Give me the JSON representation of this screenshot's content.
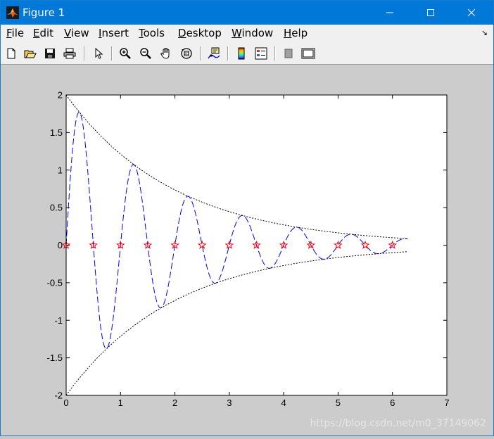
{
  "window": {
    "title": "Figure 1",
    "icons": {
      "app": "matlab-logo-icon",
      "minimize": "minimize-icon",
      "maximize": "maximize-icon",
      "close": "close-icon"
    }
  },
  "menubar": {
    "items": [
      {
        "label": "File",
        "key": "F"
      },
      {
        "label": "Edit",
        "key": "E"
      },
      {
        "label": "View",
        "key": "V"
      },
      {
        "label": "Insert",
        "key": "I"
      },
      {
        "label": "Tools",
        "key": "T"
      },
      {
        "label": "Desktop",
        "key": "D"
      },
      {
        "label": "Window",
        "key": "W"
      },
      {
        "label": "Help",
        "key": "H"
      }
    ],
    "dock_icon": "dock-arrow-icon"
  },
  "toolbar": {
    "buttons": [
      "new-figure-icon",
      "open-file-icon",
      "save-icon",
      "print-icon",
      "select-arrow-icon",
      "zoom-in-icon",
      "zoom-out-icon",
      "pan-hand-icon",
      "rotate-3d-icon",
      "data-cursor-icon",
      "colorbar-icon",
      "legend-icon",
      "hide-plot-tools-icon",
      "show-plot-tools-icon"
    ]
  },
  "chart_data": {
    "type": "line",
    "xlim": [
      0,
      7
    ],
    "ylim": [
      -2,
      2
    ],
    "xticks": [
      "0",
      "1",
      "2",
      "3",
      "4",
      "5",
      "6",
      "7"
    ],
    "yticks": [
      "2",
      "1.5",
      "1",
      "0.5",
      "0",
      "-0.5",
      "-1",
      "-1.5",
      "-2"
    ],
    "grid": false,
    "series": [
      {
        "style": "dashed",
        "color": "#0000ff",
        "function": "2*exp(-0.5*t)*sin(2*pi*t)",
        "t_range": [
          0,
          6.283
        ]
      },
      {
        "style": "dotted",
        "color": "#000000",
        "function": "2*exp(-0.5*t)",
        "t_range": [
          0,
          6.283
        ]
      },
      {
        "style": "dotted",
        "color": "#000000",
        "function": "-2*exp(-0.5*t)",
        "t_range": [
          0,
          6.283
        ]
      },
      {
        "style": "pentagram-markers",
        "color": "#ff0000",
        "x": [
          0,
          0.5,
          1,
          1.5,
          2,
          2.5,
          3,
          3.5,
          4,
          4.5,
          5,
          5.5,
          6
        ],
        "y": [
          0,
          0,
          0,
          0,
          0,
          0,
          0,
          0,
          0,
          0,
          0,
          0,
          0
        ]
      }
    ]
  },
  "watermark": "https://blog.csdn.net/m0_37149062"
}
